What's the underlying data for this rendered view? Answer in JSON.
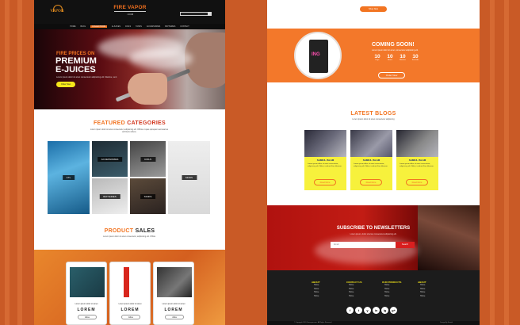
{
  "left": {
    "logo": "VAPOR",
    "brand": "FIRE VAPOR",
    "brand_suffix": ".COM",
    "nav": [
      "Home",
      "Blog",
      "Collections",
      "E-Juices",
      "Coils",
      "Tanks",
      "Accessories",
      "Batteries",
      "Contact"
    ],
    "hero_line1": "FIRE PRICES ON",
    "hero_line2": "PREMIUM",
    "hero_line3": "E-JUICES",
    "hero_sub": "Lorem ipsum dolor sit amet consectetur adipisicing elit. Maxime, sunt",
    "hero_button": "Order Now",
    "featured_a": "FEATURED",
    "featured_b": "CATEGORIES",
    "featured_sub": "Lorem ipsum dolor sit amet consectetur, adipisicing elit. Officia ut quas quisquam accusamus architecto labore",
    "categories": [
      "CTL",
      "ACCESSORIES",
      "COILS",
      "MODS",
      "BATTERIES",
      "TANKS"
    ],
    "product_a": "PRODUCT",
    "product_b": "SALES",
    "product_sub": "Lorem ipsum dolor sit amet consectetur, adipisicing elit. Officia",
    "products": [
      {
        "name": "Lorem ipsum dolor sit amet",
        "title": "LOREM",
        "button": "Elisa"
      },
      {
        "name": "Lorem ipsum dolor sit amet",
        "title": "LOREM",
        "button": "Elisa"
      },
      {
        "name": "Lorem ipsum dolor sit amet",
        "title": "LOREM",
        "button": "Alika"
      }
    ]
  },
  "right": {
    "top_button": "Shop Now",
    "coming_title": "COMING SOON!",
    "coming_sub": "Lorem ipsum dolor sit amet, consectetur adipisicing elit.",
    "countdown": [
      {
        "value": "10",
        "unit": "Days"
      },
      {
        "value": "10",
        "unit": "Hours"
      },
      {
        "value": "10",
        "unit": "Minutes"
      },
      {
        "value": "10",
        "unit": "Seconds"
      }
    ],
    "order_button": "Order Now",
    "product_label": "ING",
    "blogs_title": "LATEST BLOGS",
    "blogs_sub": "Lorem ipsum dolor sit amet consectetur adipiscing",
    "blogs": [
      {
        "author": "SAMIUL ISLAM",
        "text": "Lorem ipsum dolor sit amet consectetur, adipisicing elit. Nobis, incidunt illum laborum.",
        "button": "Read More"
      },
      {
        "author": "SAMIUL ISLAM",
        "text": "Lorem ipsum dolor sit amet consectetur, adipisicing elit. Nobis, incidunt illum laborum.",
        "button": "Read More"
      },
      {
        "author": "SAMIUL ISLAM",
        "text": "Lorem ipsum dolor sit amet consectetur, adipisicing elit. Nobis, incidunt illum laborum.",
        "button": "Read More"
      }
    ],
    "newsletter_title": "SUBSCRIBE TO NEWSLETTERS",
    "newsletter_sub": "Lorem ipsum, dolor sit amet consectetur adipisicing elit.",
    "newsletter_placeholder": "Email",
    "newsletter_button": "Search",
    "footer_cols": [
      {
        "title": "ABOUT",
        "items": [
          "Home",
          "Home",
          "Home",
          "Home"
        ]
      },
      {
        "title": "CONTACT US",
        "items": [
          "Home",
          "Home",
          "Home",
          "Home"
        ]
      },
      {
        "title": "OUR PRODUCTS",
        "items": [
          "Home",
          "Home",
          "Home",
          "Home"
        ]
      },
      {
        "title": "ABOUT",
        "items": [
          "Home",
          "Home",
          "Home",
          "Home"
        ]
      }
    ],
    "social": [
      "f",
      "t",
      "y",
      "in",
      "ig",
      "g+"
    ],
    "copyright": "© Copyright 2019 Firevapor.com. All Rights Reserved",
    "credit": "Design By Samiul"
  },
  "colors": {
    "accent": "#f27421",
    "yellow": "#f5e71a",
    "red": "#c21c14",
    "bg": "#c95a26"
  }
}
